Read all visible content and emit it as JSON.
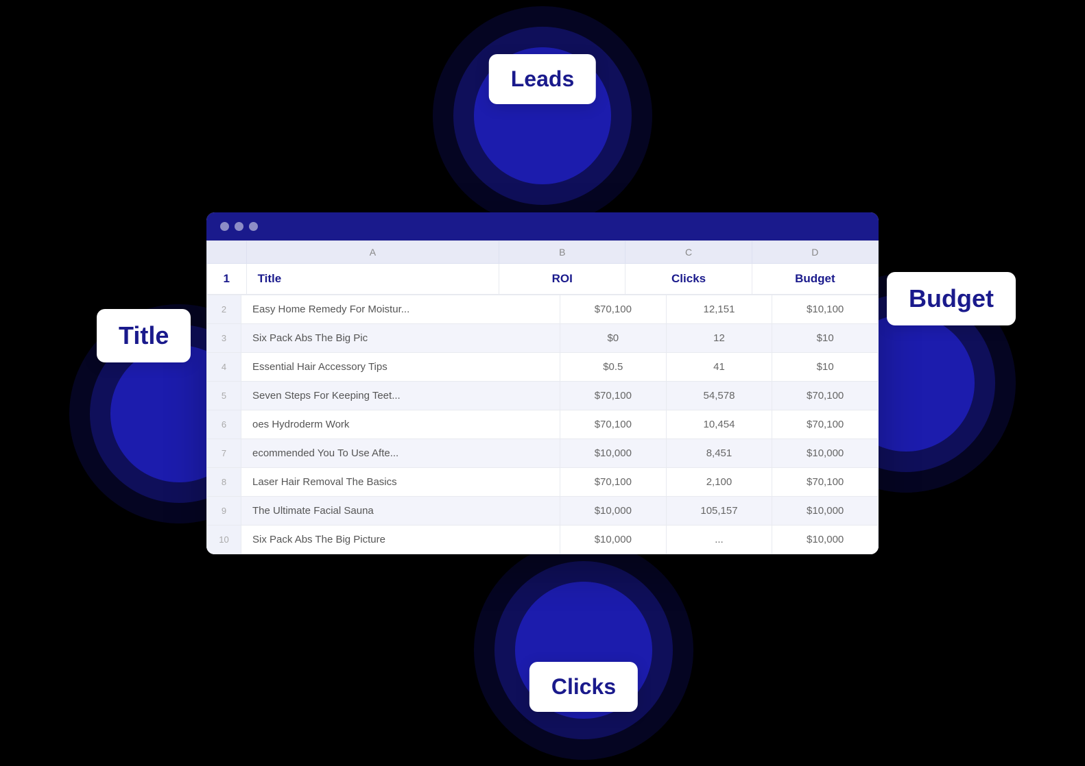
{
  "scene": {
    "floating_labels": {
      "leads": "Leads",
      "title": "Title",
      "budget": "Budget",
      "clicks": "Clicks"
    }
  },
  "window": {
    "titlebar": {
      "dots": [
        "dot1",
        "dot2",
        "dot3"
      ]
    }
  },
  "spreadsheet": {
    "col_headers": {
      "row_num": "",
      "a": "A",
      "b": "B",
      "c": "C",
      "d": "D"
    },
    "header_row": {
      "row_num": "1",
      "title": "Title",
      "roi": "ROI",
      "clicks": "Clicks",
      "budget": "Budget"
    },
    "rows": [
      {
        "num": "2",
        "title": "Easy Home Remedy For Moistur...",
        "roi": "$70,100",
        "clicks": "12,151",
        "budget": "$10,100"
      },
      {
        "num": "3",
        "title": "Six Pack Abs The Big Pic",
        "roi": "$0",
        "clicks": "12",
        "budget": "$10"
      },
      {
        "num": "4",
        "title": "Essential Hair Accessory Tips",
        "roi": "$0.5",
        "clicks": "41",
        "budget": "$10"
      },
      {
        "num": "5",
        "title": "Seven Steps For Keeping Teet...",
        "roi": "$70,100",
        "clicks": "54,578",
        "budget": "$70,100"
      },
      {
        "num": "6",
        "title": "oes Hydroderm Work",
        "roi": "$70,100",
        "clicks": "10,454",
        "budget": "$70,100"
      },
      {
        "num": "7",
        "title": "ecommended You To Use Afte...",
        "roi": "$10,000",
        "clicks": "8,451",
        "budget": "$10,000"
      },
      {
        "num": "8",
        "title": "Laser Hair Removal The Basics",
        "roi": "$70,100",
        "clicks": "2,100",
        "budget": "$70,100"
      },
      {
        "num": "9",
        "title": "The Ultimate Facial Sauna",
        "roi": "$10,000",
        "clicks": "105,157",
        "budget": "$10,000"
      },
      {
        "num": "10",
        "title": "Six Pack Abs The Big Picture",
        "roi": "$10,000",
        "clicks": "...",
        "budget": "$10,000"
      }
    ]
  }
}
